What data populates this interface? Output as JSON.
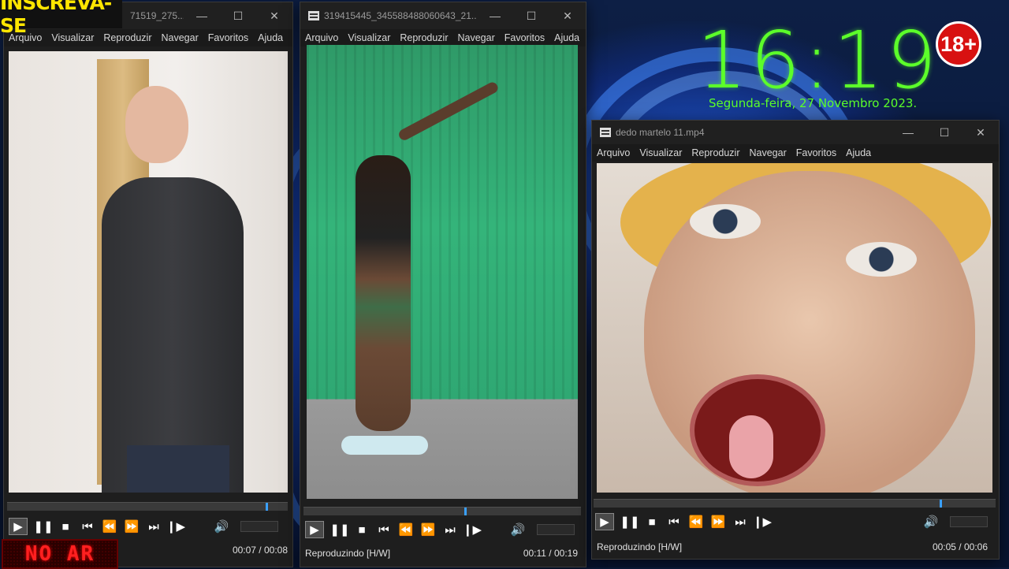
{
  "overlay": {
    "subscribe_label": "INSCREVA-SE",
    "live_label": "NO AR",
    "age_badge": "18+",
    "clock_time": "16:19",
    "clock_date": "Segunda-feira, 27 Novembro 2023."
  },
  "menu": [
    "Arquivo",
    "Visualizar",
    "Reproduzir",
    "Navegar",
    "Favoritos",
    "Ajuda"
  ],
  "players": [
    {
      "title": "71519_275...",
      "status": "",
      "time": "00:07 / 00:08",
      "progress": 0.92
    },
    {
      "title": "319415445_345588488060643_21...",
      "status": "Reproduzindo [H/W]",
      "time": "00:11 / 00:19",
      "progress": 0.58
    },
    {
      "title": "dedo martelo 11.mp4",
      "status": "Reproduzindo [H/W]",
      "time": "00:05 / 00:06",
      "progress": 0.86
    }
  ],
  "icons": {
    "play": "play-icon",
    "pause": "pause-icon",
    "stop": "stop-icon",
    "prev": "skip-back-icon",
    "rewind": "rewind-icon",
    "forward": "fast-forward-icon",
    "next": "skip-forward-icon",
    "frame": "frame-step-icon",
    "volume": "volume-icon"
  },
  "colors": {
    "accent": "#3aa0ff",
    "clock": "#5cff2a",
    "badge": "#d81111",
    "subscribe": "#ffe600",
    "live": "#ff2020"
  }
}
